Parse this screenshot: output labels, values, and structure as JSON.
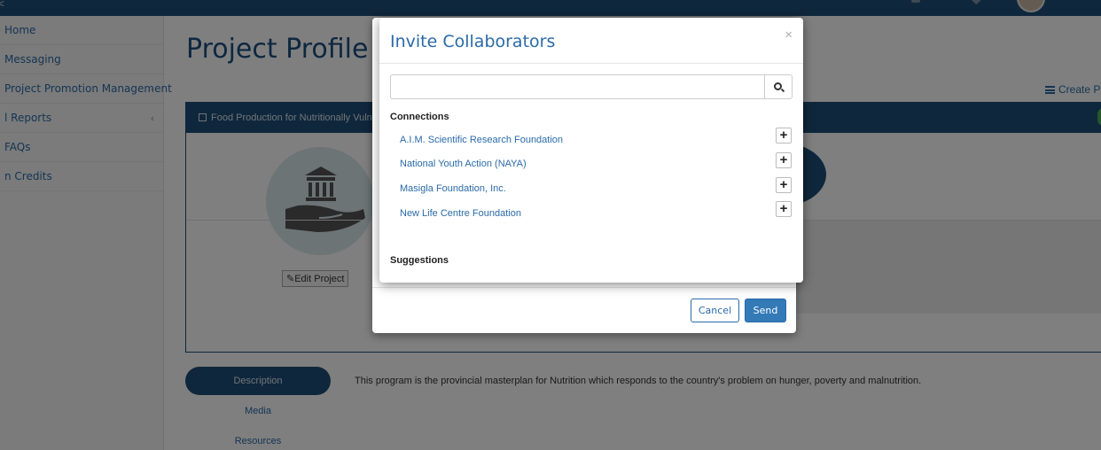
{
  "sidebar": {
    "items": [
      {
        "label": "Home",
        "chevron": false
      },
      {
        "label": "Messaging",
        "chevron": false
      },
      {
        "label": "Project Promotion Management",
        "chevron": true
      },
      {
        "label": "l Reports",
        "chevron": true
      },
      {
        "label": "FAQs",
        "chevron": false
      },
      {
        "label": "n Credits",
        "chevron": false
      }
    ]
  },
  "page": {
    "title": "Project Profile",
    "create_link": "Create Pr",
    "project_header": "Food Production for Nutritionally Vulne",
    "edit_button": "Edit Project",
    "tabs": [
      "Description",
      "Media",
      "Resources"
    ],
    "description": "This program is the provincial masterplan for Nutrition which responds to the country's problem on hunger, poverty and malnutrition."
  },
  "modal": {
    "title": "Invite Collaborators",
    "close": "×",
    "search": {
      "value": "",
      "placeholder": ""
    },
    "connections_title": "Connections",
    "connections": [
      "A.I.M. Scientific Research Foundation",
      "National Youth Action (NAYA)",
      "Masigla Foundation, Inc.",
      "New Life Centre Foundation"
    ],
    "suggestions_title": "Suggestions",
    "add_symbol": "+",
    "cancel_label": "Cancel",
    "send_label": "Send"
  },
  "colors": {
    "brand_navy": "#1f4e79",
    "link_blue": "#2a6aa8",
    "primary_button": "#337ab7"
  }
}
